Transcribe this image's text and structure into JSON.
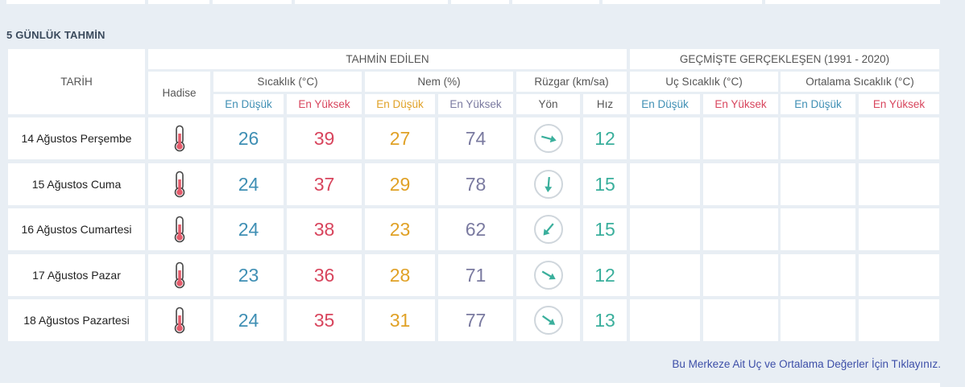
{
  "section_title": "5 GÜNLÜK TAHMİN",
  "headers": {
    "date": "TARİH",
    "forecast": "TAHMİN EDİLEN",
    "history": "GEÇMİŞTE GERÇEKLEŞEN (1991 - 2020)",
    "event": "Hadise",
    "temp": "Sıcaklık (°C)",
    "humidity": "Nem (%)",
    "wind": "Rüzgar (km/sa)",
    "extreme_temp": "Uç Sıcaklık (°C)",
    "avg_temp": "Ortalama Sıcaklık (°C)",
    "low": "En Düşük",
    "high": "En Yüksek",
    "direction": "Yön",
    "speed": "Hız"
  },
  "rows": [
    {
      "date": "14 Ağustos Perşembe",
      "event_icon": "thermometer-icon",
      "temp_low": "26",
      "temp_high": "39",
      "hum_low": "27",
      "hum_high": "74",
      "wind_dir_icon": "wind-arrow-icon",
      "wind_deg": 105,
      "wind_speed": "12"
    },
    {
      "date": "15 Ağustos Cuma",
      "event_icon": "thermometer-icon",
      "temp_low": "24",
      "temp_high": "37",
      "hum_low": "29",
      "hum_high": "78",
      "wind_dir_icon": "wind-arrow-icon",
      "wind_deg": 185,
      "wind_speed": "15"
    },
    {
      "date": "16 Ağustos Cumartesi",
      "event_icon": "thermometer-icon",
      "temp_low": "24",
      "temp_high": "38",
      "hum_low": "23",
      "hum_high": "62",
      "wind_dir_icon": "wind-arrow-icon",
      "wind_deg": 220,
      "wind_speed": "15"
    },
    {
      "date": "17 Ağustos Pazar",
      "event_icon": "thermometer-icon",
      "temp_low": "23",
      "temp_high": "36",
      "hum_low": "28",
      "hum_high": "71",
      "wind_dir_icon": "wind-arrow-icon",
      "wind_deg": 120,
      "wind_speed": "12"
    },
    {
      "date": "18 Ağustos Pazartesi",
      "event_icon": "thermometer-icon",
      "temp_low": "24",
      "temp_high": "35",
      "hum_low": "31",
      "hum_high": "77",
      "wind_dir_icon": "wind-arrow-icon",
      "wind_deg": 125,
      "wind_speed": "13"
    }
  ],
  "footer_link": "Bu Merkeze Ait Uç ve Ortalama Değerler İçin Tıklayınız.",
  "colors": {
    "low_blue": "#3f8fb4",
    "high_red": "#d8455d",
    "low_orange": "#e0a126",
    "high_gray": "#7a7aa0",
    "wind_teal": "#3aaf9c",
    "link": "#3d4fa8"
  }
}
